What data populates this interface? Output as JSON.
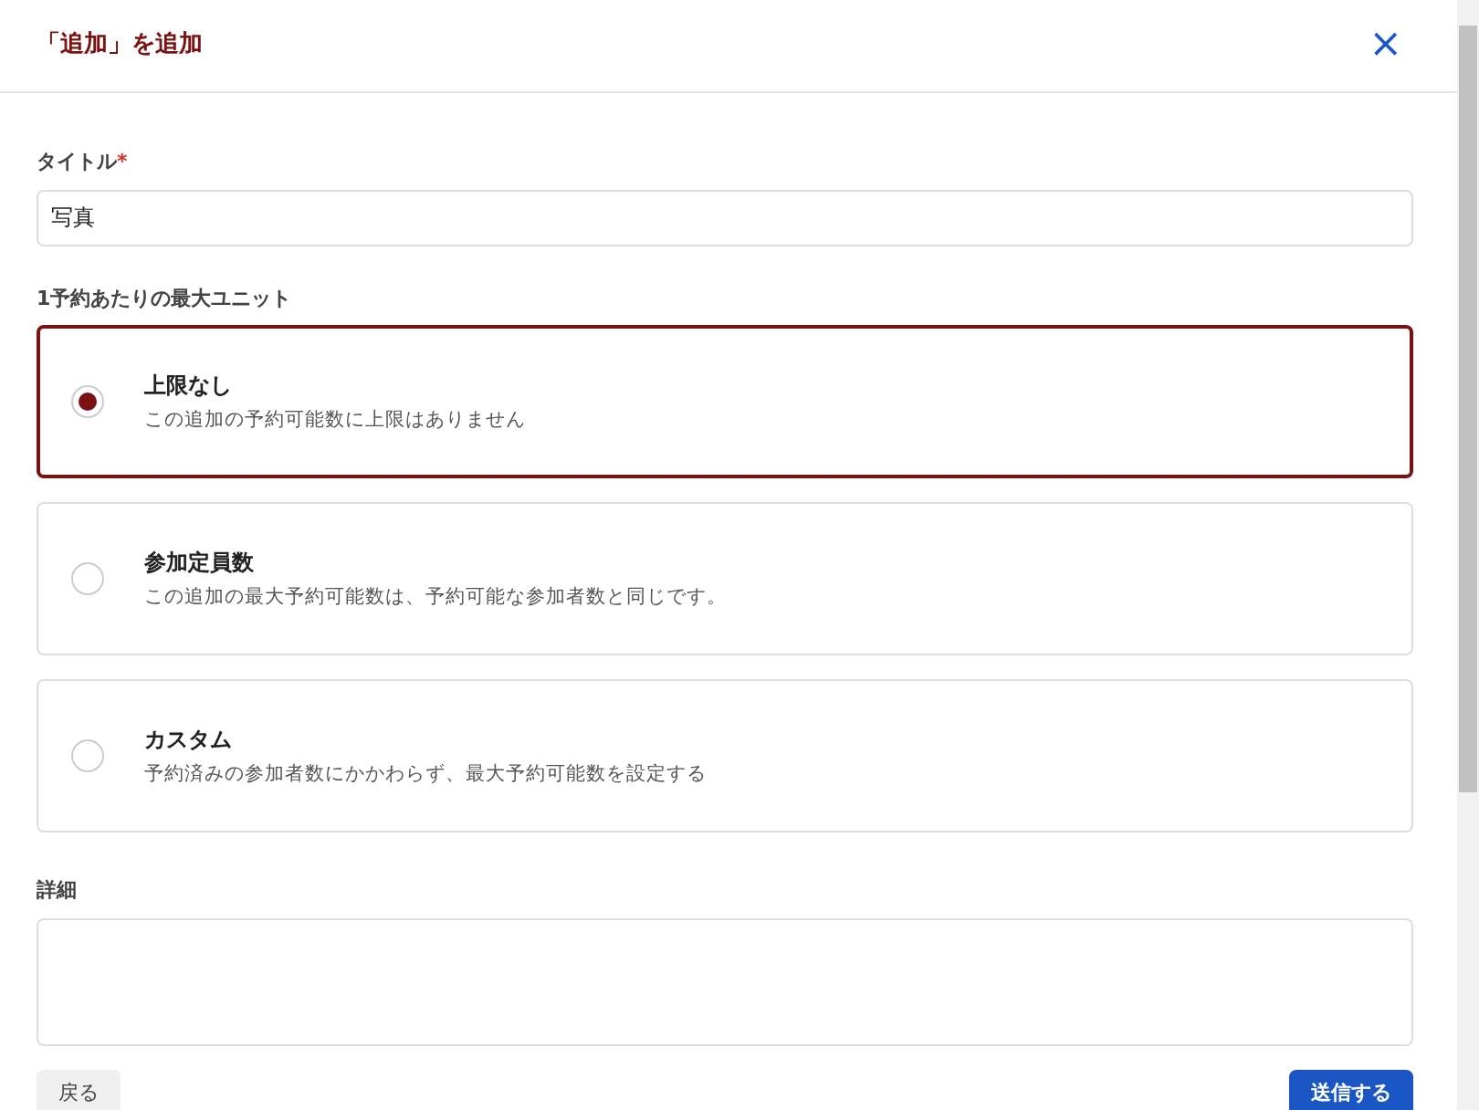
{
  "dialog": {
    "title": "「追加」を追加",
    "close": "×"
  },
  "title_field": {
    "label": "タイトル",
    "required_mark": "*",
    "value": "写真"
  },
  "max_units": {
    "label": "1予約あたりの最大ユニット",
    "options": [
      {
        "title": "上限なし",
        "description": "この追加の予約可能数に上限はありません",
        "selected": true
      },
      {
        "title": "参加定員数",
        "description": "この追加の最大予約可能数は、予約可能な参加者数と同じです。",
        "selected": false
      },
      {
        "title": "カスタム",
        "description": "予約済みの参加者数にかかわらず、最大予約可能数を設定する",
        "selected": false
      }
    ]
  },
  "details_field": {
    "label": "詳細"
  },
  "buttons": [
    {
      "label": "戻る",
      "kind": "secondary"
    },
    {
      "label": "送信する",
      "kind": "primary"
    }
  ]
}
